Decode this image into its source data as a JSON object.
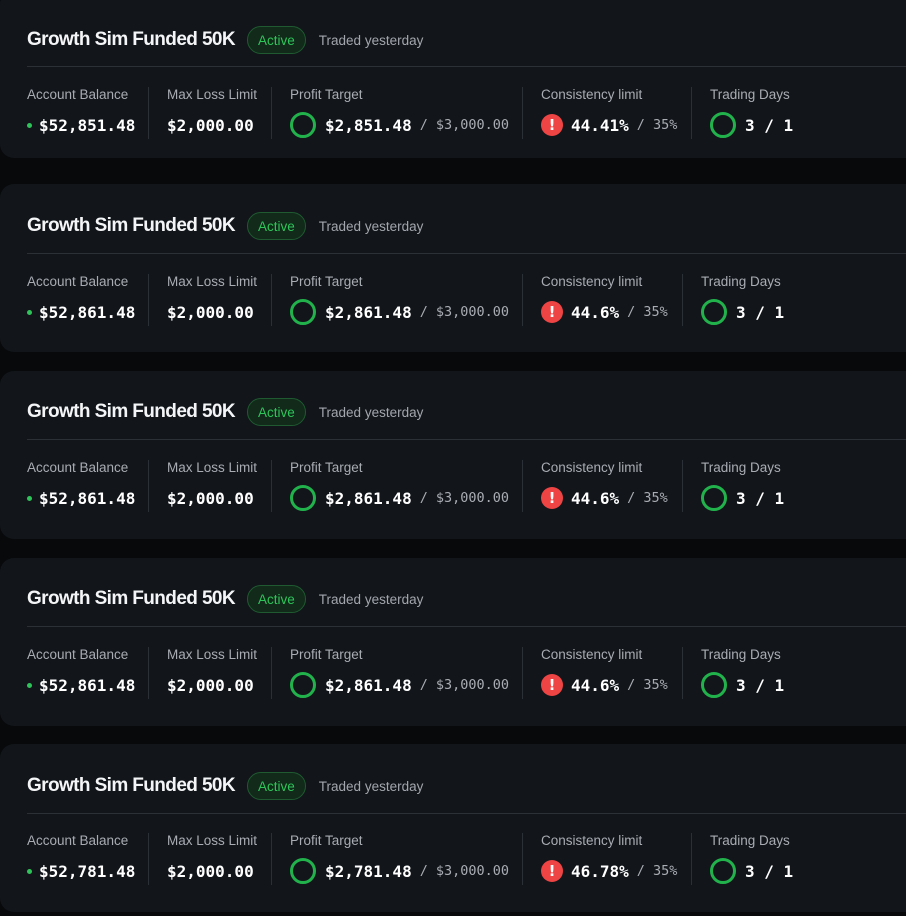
{
  "accounts": [
    {
      "title": "Growth Sim Funded 50K",
      "status": "Active",
      "last_traded": "Traded yesterday",
      "balance_label": "Account Balance",
      "balance": "$52,851.48",
      "max_loss_label": "Max Loss Limit",
      "max_loss": "$2,000.00",
      "profit_label": "Profit Target",
      "profit_current": "$2,851.48",
      "profit_target": "$3,000.00",
      "consistency_label": "Consistency limit",
      "consistency_value": "44.41%",
      "consistency_limit": "35%",
      "days_label": "Trading Days",
      "days_value": "3 / 1"
    },
    {
      "title": "Growth Sim Funded 50K",
      "status": "Active",
      "last_traded": "Traded yesterday",
      "balance_label": "Account Balance",
      "balance": "$52,861.48",
      "max_loss_label": "Max Loss Limit",
      "max_loss": "$2,000.00",
      "profit_label": "Profit Target",
      "profit_current": "$2,861.48",
      "profit_target": "$3,000.00",
      "consistency_label": "Consistency limit",
      "consistency_value": "44.6%",
      "consistency_limit": "35%",
      "days_label": "Trading Days",
      "days_value": "3 / 1"
    },
    {
      "title": "Growth Sim Funded 50K",
      "status": "Active",
      "last_traded": "Traded yesterday",
      "balance_label": "Account Balance",
      "balance": "$52,861.48",
      "max_loss_label": "Max Loss Limit",
      "max_loss": "$2,000.00",
      "profit_label": "Profit Target",
      "profit_current": "$2,861.48",
      "profit_target": "$3,000.00",
      "consistency_label": "Consistency limit",
      "consistency_value": "44.6%",
      "consistency_limit": "35%",
      "days_label": "Trading Days",
      "days_value": "3 / 1"
    },
    {
      "title": "Growth Sim Funded 50K",
      "status": "Active",
      "last_traded": "Traded yesterday",
      "balance_label": "Account Balance",
      "balance": "$52,861.48",
      "max_loss_label": "Max Loss Limit",
      "max_loss": "$2,000.00",
      "profit_label": "Profit Target",
      "profit_current": "$2,861.48",
      "profit_target": "$3,000.00",
      "consistency_label": "Consistency limit",
      "consistency_value": "44.6%",
      "consistency_limit": "35%",
      "days_label": "Trading Days",
      "days_value": "3 / 1"
    },
    {
      "title": "Growth Sim Funded 50K",
      "status": "Active",
      "last_traded": "Traded yesterday",
      "balance_label": "Account Balance",
      "balance": "$52,781.48",
      "max_loss_label": "Max Loss Limit",
      "max_loss": "$2,000.00",
      "profit_label": "Profit Target",
      "profit_current": "$2,781.48",
      "profit_target": "$3,000.00",
      "consistency_label": "Consistency limit",
      "consistency_value": "46.78%",
      "consistency_limit": "35%",
      "days_label": "Trading Days",
      "days_value": "3 / 1"
    }
  ],
  "colors": {
    "accent_green": "#2ec45a",
    "warning_red": "#ef4444",
    "card_bg": "#12161b",
    "page_bg": "#07090b"
  },
  "icons": {
    "balance_indicator": "status-dot-icon",
    "profit_progress": "progress-ring-icon",
    "consistency_warning": "exclamation-icon",
    "days_progress": "progress-ring-icon"
  }
}
